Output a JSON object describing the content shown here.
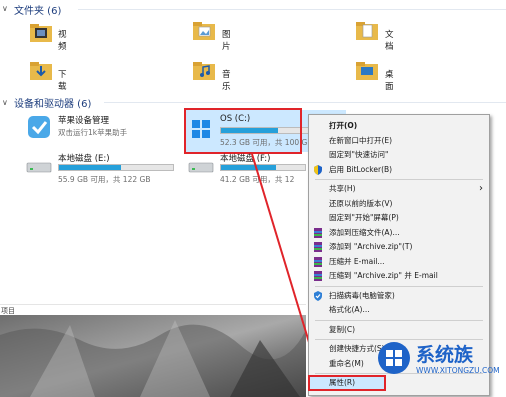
{
  "sections": {
    "folders": {
      "title": "文件夹 (6)"
    },
    "devices": {
      "title": "设备和驱动器 (6)"
    }
  },
  "folders": [
    {
      "name": "视频",
      "icon": "video-folder-icon"
    },
    {
      "name": "图片",
      "icon": "pictures-folder-icon"
    },
    {
      "name": "文档",
      "icon": "documents-folder-icon"
    },
    {
      "name": "下载",
      "icon": "downloads-folder-icon"
    },
    {
      "name": "音乐",
      "icon": "music-folder-icon"
    },
    {
      "name": "桌面",
      "icon": "desktop-folder-icon"
    }
  ],
  "devices": [
    {
      "name": "苹果设备管理",
      "detail": "双击运行1k苹果助手",
      "icon": "apple-device-manager-icon"
    },
    {
      "name": "OS (C:)",
      "detail": "52.3 GB 可用，共 100 G",
      "fill": 0.48,
      "icon": "windows-drive-icon"
    },
    {
      "name": "本地磁盘 (E:)",
      "detail": "55.9 GB 可用，共 122 GB",
      "fill": 0.54,
      "icon": "hard-drive-icon"
    },
    {
      "name": "本地磁盘 (F:)",
      "detail": "41.2 GB 可用，共 12",
      "fill": 0.66,
      "icon": "hard-drive-icon"
    }
  ],
  "status": {
    "left_text": "项目"
  },
  "context_menu": {
    "items": [
      {
        "label": "打开(O)",
        "bold": true
      },
      {
        "label": "在新窗口中打开(E)"
      },
      {
        "label": "固定到\"快速访问\""
      },
      {
        "label": "启用 BitLocker(B)",
        "icon": "shield-icon"
      },
      {
        "sep": true
      },
      {
        "label": "共享(H)",
        "submenu": true
      },
      {
        "label": "还原以前的版本(V)"
      },
      {
        "label": "固定到\"开始\"屏幕(P)"
      },
      {
        "label": "添加到压缩文件(A)...",
        "icon": "winrar-icon"
      },
      {
        "label": "添加到 \"Archive.zip\"(T)",
        "icon": "winrar-icon"
      },
      {
        "label": "压缩并 E-mail...",
        "icon": "winrar-icon"
      },
      {
        "label": "压缩到 \"Archive.zip\" 并 E-mail",
        "icon": "winrar-icon"
      },
      {
        "sep": true
      },
      {
        "label": "扫描病毒(电脑管家)",
        "icon": "antivirus-icon"
      },
      {
        "label": "格式化(A)..."
      },
      {
        "sep": true
      },
      {
        "label": "复制(C)"
      },
      {
        "sep": true
      },
      {
        "label": "创建快捷方式(S)"
      },
      {
        "label": "重命名(M)"
      },
      {
        "sep": true
      },
      {
        "label": "属性(R)",
        "highlight": true
      }
    ]
  },
  "watermark": {
    "brand": "系统族",
    "url": "WWW.XITONGZU.COM"
  },
  "colors": {
    "accent": "#26a0da",
    "highlight": "#e0242a",
    "header": "#1e3e7e"
  }
}
